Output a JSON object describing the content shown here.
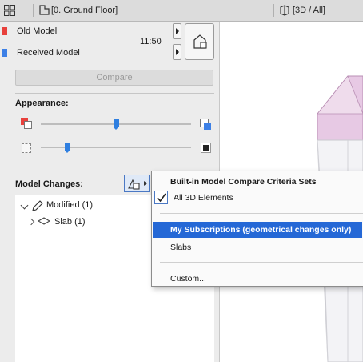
{
  "topbar": {
    "floor_label": "[0. Ground Floor]",
    "view_label": "[3D / All]"
  },
  "models": {
    "old_label": "Old Model",
    "received_label": "Received Model",
    "time": "11:50"
  },
  "compare_button": "Compare",
  "appearance": {
    "title": "Appearance:",
    "slider1_level": 0.5,
    "slider2_level": 0.18
  },
  "model_changes": {
    "title": "Model Changes:",
    "tree": [
      {
        "label": "Modified (1)"
      },
      {
        "label": "Slab (1)"
      }
    ]
  },
  "menu": {
    "header": "Built-in Model Compare Criteria Sets",
    "items": [
      {
        "label": "All 3D Elements",
        "checked": true
      },
      {
        "label": "My Subscriptions (geometrical changes only)",
        "highlighted": true
      },
      {
        "label": "Slabs"
      },
      {
        "label": "Custom..."
      }
    ]
  },
  "colors": {
    "old_model": "#e8413c",
    "received_model": "#3d80e6",
    "highlight": "#2568d6",
    "slab_top": "#e7c9e4"
  }
}
